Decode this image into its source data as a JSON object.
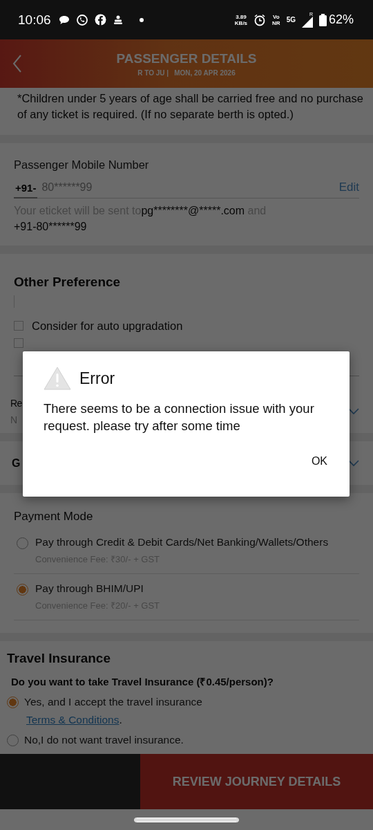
{
  "status_bar": {
    "time": "10:06",
    "speed": "3.89",
    "speed_unit": "KB/s",
    "volte": "Vo",
    "volte_sub": "NR",
    "network": "5G",
    "roaming": "R",
    "battery": "62%"
  },
  "header": {
    "title": "PASSENGER DETAILS",
    "route": "R TO JU |",
    "date": "MON, 20 APR  2026"
  },
  "children_note": "*Children under 5 years of age shall be carried free and no purchase of any ticket is required. (If no separate berth is opted.)",
  "mobile": {
    "label": "Passenger Mobile Number",
    "prefix": "+91-",
    "placeholder": "80******99",
    "edit": "Edit",
    "info_parts": [
      {
        "text": "Your eticket will be sent to",
        "emphasis": false
      },
      {
        "text": "pg********@*****.com",
        "emphasis": true
      },
      {
        "text": " and",
        "emphasis": false
      },
      {
        "text": "+91-80******99",
        "emphasis": true,
        "new_line": true
      }
    ]
  },
  "other_preference": {
    "title": "Other Preference",
    "checkboxes": [
      {
        "label": "Consider for auto upgradation",
        "checked": false
      },
      {
        "checked": false
      }
    ],
    "partial_rows": [
      {
        "title": "Re",
        "value": "N",
        "expanded": true
      },
      {
        "title": "G",
        "expanded": true
      }
    ]
  },
  "payment_mode": {
    "title": "Payment Mode",
    "options": [
      {
        "label": "Pay through Credit & Debit Cards/Net Banking/Wallets/Others",
        "fee": "Convenience Fee: ₹30/- + GST",
        "selected": false
      },
      {
        "label": "Pay through BHIM/UPI",
        "fee": "Convenience Fee: ₹20/- + GST",
        "selected": true
      }
    ]
  },
  "travel_insurance": {
    "title": "Travel Insurance",
    "question": "Do you want to take Travel Insurance (₹0.45/person)?",
    "options": [
      {
        "label": "Yes, and I accept the travel insurance",
        "link": "Terms & Conditions",
        "link_suffix": ".",
        "selected": true
      },
      {
        "label": "No,I do not want travel insurance.",
        "selected": false
      }
    ]
  },
  "footer": {
    "button": "REVIEW JOURNEY DETAILS"
  },
  "dialog": {
    "title": "Error",
    "message": "There seems to be a connection issue with your request. please try after some time",
    "button": "OK"
  }
}
